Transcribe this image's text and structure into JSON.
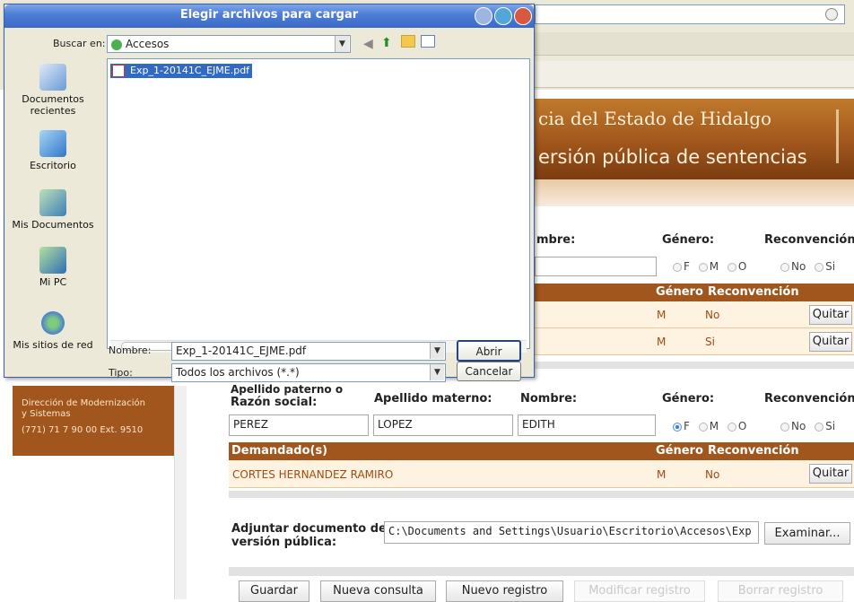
{
  "browser": {},
  "banner": {
    "title": "cia del Estado de Hidalgo",
    "subtitle": "ersión pública de sentencias"
  },
  "section1": {
    "nombre_label": "mbre:",
    "genero_label": "Género:",
    "reconvencion_label": "Reconvención:",
    "genero_options": [
      "F",
      "M",
      "O"
    ],
    "reconvencion_options": [
      "No",
      "Si"
    ],
    "table_headers": {
      "genero": "Género",
      "reconvencion": "Reconvención"
    },
    "rows": [
      {
        "genero": "M",
        "reconvencion": "No",
        "action": "Quitar"
      },
      {
        "genero": "M",
        "reconvencion": "Si",
        "action": "Quitar"
      }
    ]
  },
  "left_panel": {
    "line1": "Dirección de Modernización",
    "line2": "y Sistemas",
    "line3": "(771) 71 7 90 00 Ext. 9510"
  },
  "section2": {
    "apellido_paterno_label": "Apellido paterno o",
    "razon_social_label": "Razón social:",
    "apellido_materno_label": "Apellido materno:",
    "nombre_label": "Nombre:",
    "genero_label": "Género:",
    "reconvencion_label": "Reconvención:",
    "apellido_paterno_value": "PEREZ",
    "apellido_materno_value": "LOPEZ",
    "nombre_value": "EDITH",
    "genero_options": [
      "F",
      "M",
      "O"
    ],
    "reconvencion_options": [
      "No",
      "Si"
    ],
    "demandados_header": "Demandado(s)",
    "table_headers": {
      "genero": "Género",
      "reconvencion": "Reconvención"
    },
    "rows": [
      {
        "name": "CORTES HERNANDEZ RAMIRO",
        "genero": "M",
        "reconvencion": "No",
        "action": "Quitar"
      }
    ]
  },
  "attach": {
    "label_line1": "Adjuntar documento de",
    "label_line2": "versión pública:",
    "path_value": "C:\\Documents and Settings\\Usuario\\Escritorio\\Accesos\\Exp",
    "browse_button": "Examinar..."
  },
  "actions": {
    "guardar": "Guardar",
    "nueva_consulta": "Nueva consulta",
    "nuevo_registro": "Nuevo registro",
    "modificar_registro": "Modificar registro",
    "borrar_registro": "Borrar registro"
  },
  "dialog": {
    "title": "Elegir archivos para cargar",
    "look_in_label": "Buscar en:",
    "look_in_value": "Accesos",
    "places": [
      {
        "label_1": "Documentos",
        "label_2": "recientes",
        "icon": "recent-documents-icon"
      },
      {
        "label_1": "Escritorio",
        "label_2": "",
        "icon": "desktop-icon"
      },
      {
        "label_1": "Mis Documentos",
        "label_2": "",
        "icon": "my-documents-icon"
      },
      {
        "label_1": "Mi PC",
        "label_2": "",
        "icon": "my-computer-icon"
      },
      {
        "label_1": "Mis sitios de red",
        "label_2": "",
        "icon": "network-places-icon"
      }
    ],
    "file_item": "Exp_1-20141C_EJME.pdf",
    "filename_label": "Nombre:",
    "filename_value": "Exp_1-20141C_EJME.pdf",
    "filetype_label": "Tipo:",
    "filetype_value": "Todos los archivos (*.*)",
    "open_button": "Abrir",
    "cancel_button": "Cancelar"
  },
  "colors": {
    "accent": "#a0561c",
    "title_bar": "#3b69c8",
    "selection": "#316ac5"
  }
}
